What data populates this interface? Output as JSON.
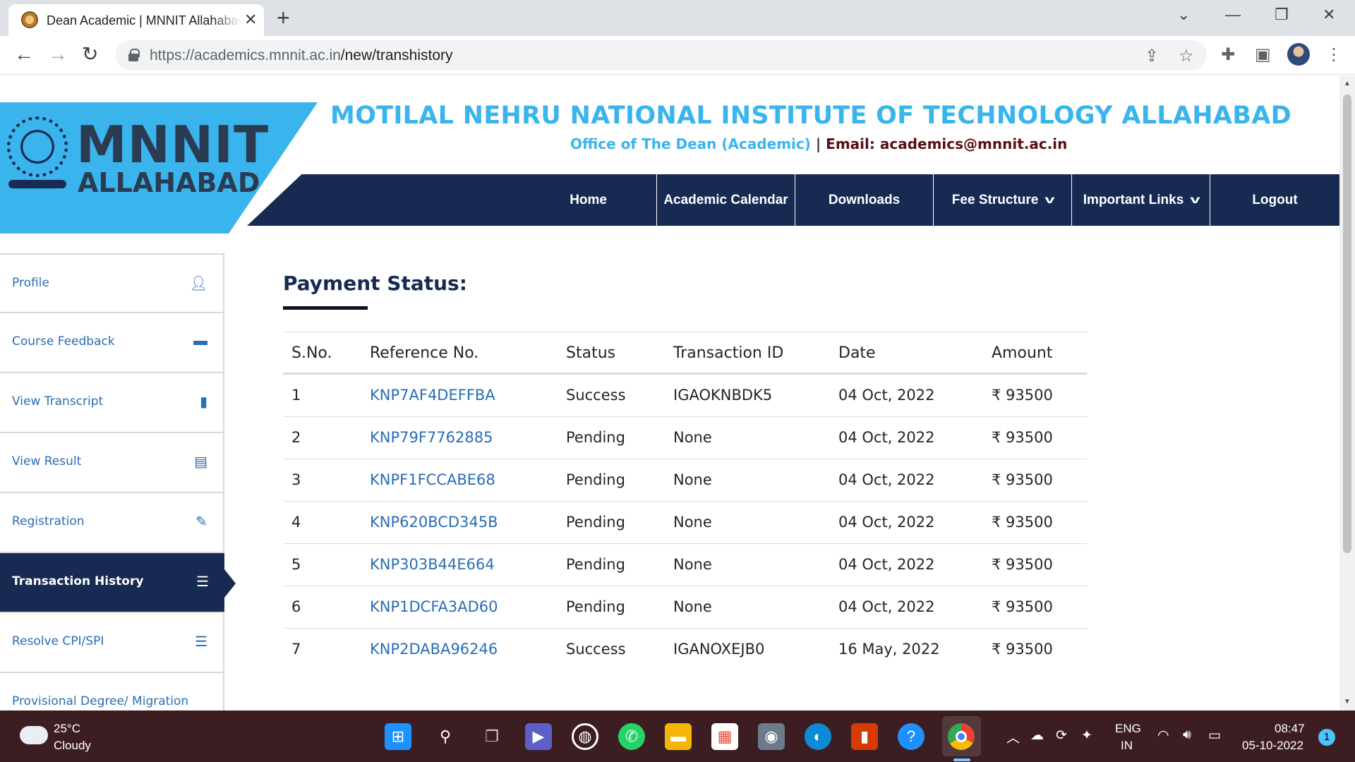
{
  "browser": {
    "tab_title": "Dean Academic | MNNIT Allahabad",
    "url_host": "https://academics.mnnit.ac.in",
    "url_path": "/new/transhistory"
  },
  "site": {
    "logo_main": "MNNIT",
    "logo_sub": "ALLAHABAD",
    "institute_name": "MOTILAL NEHRU NATIONAL INSTITUTE OF TECHNOLOGY ALLAHABAD",
    "office": "Office of The Dean (Academic)",
    "separator": "|",
    "email_line": "Email: academics@mnnit.ac.in"
  },
  "nav": {
    "items": [
      {
        "label": "Home"
      },
      {
        "label": "Academic Calendar"
      },
      {
        "label": "Downloads"
      },
      {
        "label": "Fee Structure",
        "dropdown": true
      },
      {
        "label": "Important Links",
        "dropdown": true
      },
      {
        "label": "Logout"
      }
    ]
  },
  "sidebar": {
    "items": [
      {
        "label": "Profile",
        "icon": "user-icon"
      },
      {
        "label": "Course Feedback",
        "icon": "comment-icon"
      },
      {
        "label": "View Transcript",
        "icon": "file-icon"
      },
      {
        "label": "View Result",
        "icon": "list-alt-icon"
      },
      {
        "label": "Registration",
        "icon": "pencil-icon"
      },
      {
        "label": "Transaction History",
        "icon": "list-icon",
        "active": true
      },
      {
        "label": "Resolve CPI/SPI",
        "icon": "list-icon"
      },
      {
        "label": "Provisional Degree/ Migration",
        "icon": ""
      }
    ]
  },
  "payment": {
    "title": "Payment Status:",
    "columns": [
      "S.No.",
      "Reference No.",
      "Status",
      "Transaction ID",
      "Date",
      "Amount"
    ],
    "rows": [
      {
        "sno": "1",
        "ref": "KNP7AF4DEFFBA",
        "status": "Success",
        "txn": "IGAOKNBDK5",
        "date": "04 Oct, 2022",
        "amount": "₹ 93500"
      },
      {
        "sno": "2",
        "ref": "KNP79F7762885",
        "status": "Pending",
        "txn": "None",
        "date": "04 Oct, 2022",
        "amount": "₹ 93500"
      },
      {
        "sno": "3",
        "ref": "KNPF1FCCABE68",
        "status": "Pending",
        "txn": "None",
        "date": "04 Oct, 2022",
        "amount": "₹ 93500"
      },
      {
        "sno": "4",
        "ref": "KNP620BCD345B",
        "status": "Pending",
        "txn": "None",
        "date": "04 Oct, 2022",
        "amount": "₹ 93500"
      },
      {
        "sno": "5",
        "ref": "KNP303B44E664",
        "status": "Pending",
        "txn": "None",
        "date": "04 Oct, 2022",
        "amount": "₹ 93500"
      },
      {
        "sno": "6",
        "ref": "KNP1DCFA3AD60",
        "status": "Pending",
        "txn": "None",
        "date": "04 Oct, 2022",
        "amount": "₹ 93500"
      },
      {
        "sno": "7",
        "ref": "KNP2DABA96246",
        "status": "Success",
        "txn": "IGANOXEJB0",
        "date": "16 May, 2022",
        "amount": "₹ 93500"
      }
    ]
  },
  "taskbar": {
    "weather_temp": "25°C",
    "weather_cond": "Cloudy",
    "lang_1": "ENG",
    "lang_2": "IN",
    "time": "08:47",
    "date": "05-10-2022",
    "notifications": "1"
  },
  "colors": {
    "accent_blue": "#3ab4ec",
    "navy": "#162a52",
    "link_blue": "#2a6db3"
  }
}
